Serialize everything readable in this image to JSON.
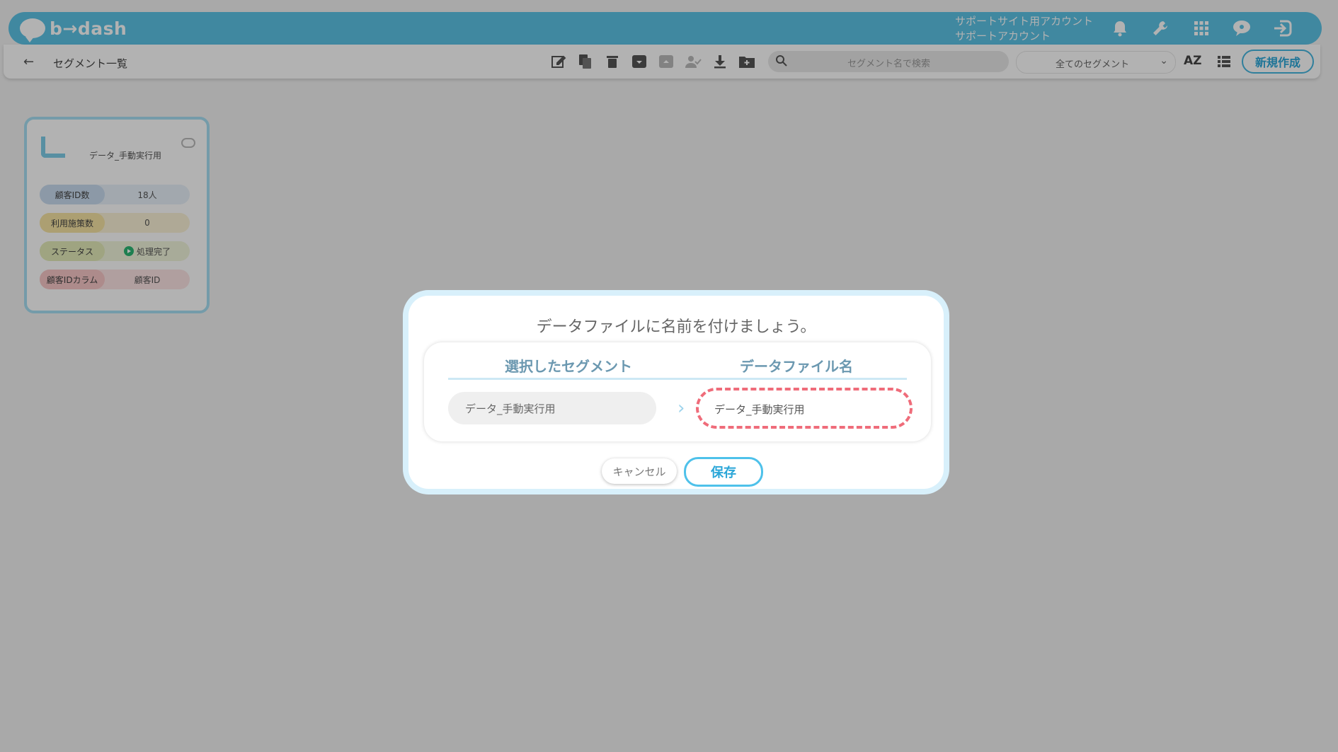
{
  "header": {
    "logo_text": "b→dash",
    "account_line1": "サポートサイト用アカウント",
    "account_line2": "サポートアカウント",
    "icons": [
      "bell-icon",
      "wrench-icon",
      "apps-grid-icon",
      "chat-icon",
      "logout-icon"
    ]
  },
  "toolbar": {
    "back_symbol": "←",
    "breadcrumb": "セグメント一覧",
    "tool_icons": [
      "edit-icon",
      "copy-icon",
      "trash-icon",
      "archive-icon",
      "unarchive-icon",
      "user-check-icon",
      "download-icon",
      "folder-plus-icon"
    ],
    "search_placeholder": "セグメント名で検索",
    "filter_selected": "全てのセグメント",
    "sort_label": "AZ",
    "new_button": "新規作成"
  },
  "card": {
    "title": "データ_手動実行用",
    "stats": [
      {
        "label": "顧客ID数",
        "value": "18人",
        "label_color": "#c9dcef",
        "value_color": "#e8f1fa"
      },
      {
        "label": "利用施策数",
        "value": "0",
        "label_color": "#f6e4a4",
        "value_color": "#fbf3d7"
      },
      {
        "label": "ステータス",
        "value": "処理完了",
        "label_color": "#e4ebb9",
        "value_color": "#f1f5dc"
      },
      {
        "label": "顧客IDカラム",
        "value": "顧客ID",
        "label_color": "#f8c8c8",
        "value_color": "#fce4e4"
      }
    ]
  },
  "modal": {
    "title": "データファイルに名前を付けましょう。",
    "col_left": "選択したセグメント",
    "col_right": "データファイル名",
    "selected_segment": "データ_手動実行用",
    "file_name_value": "データ_手動実行用",
    "cancel_label": "キャンセル",
    "save_label": "保存"
  },
  "colors": {
    "brand": "#5cc3e6",
    "accent_text": "#2aa6d8",
    "highlight_dash": "#ef6c7a"
  }
}
